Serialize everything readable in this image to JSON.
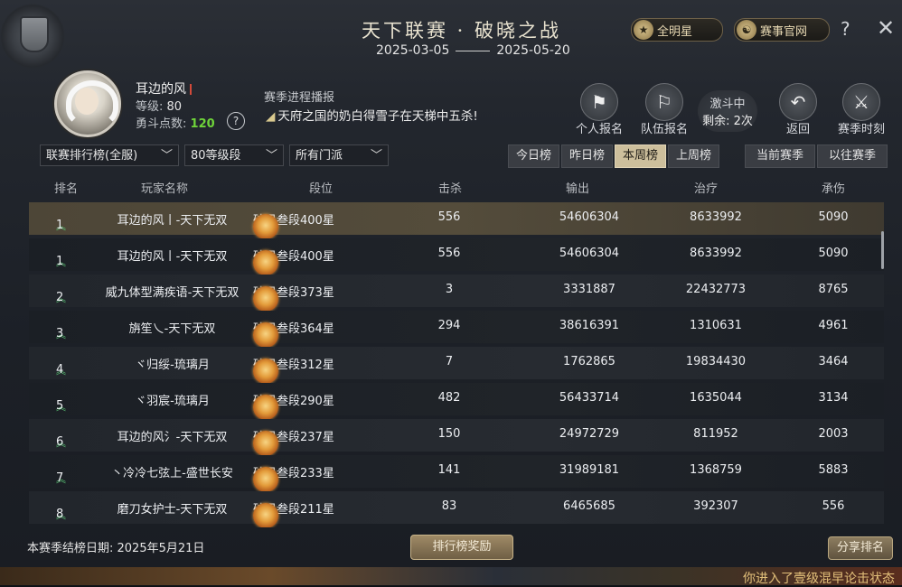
{
  "header": {
    "title": "天下联赛 · 破晓之战",
    "date_start": "2025-03-05",
    "date_end": "2025-05-20",
    "btn_allstar": "全明星",
    "btn_official": "赛事官网",
    "help": "?",
    "close": "✕"
  },
  "player": {
    "name": "耳边的风",
    "level_label": "等级:",
    "level_value": "80",
    "points_label": "勇斗点数:",
    "points_value": "120",
    "help": "?"
  },
  "news": {
    "title": "赛季进程播报",
    "body": "天府之国的奶白得雪子在天梯中五杀!"
  },
  "actions": {
    "solo": "个人报名",
    "team": "队伍报名",
    "fight_status": "激斗中",
    "remaining": "剩余: 2次",
    "back": "返回",
    "moments": "赛季时刻"
  },
  "filters": {
    "board": "联赛排行榜(全服)",
    "level": "80等级段",
    "sect": "所有门派"
  },
  "tabs": [
    "今日榜",
    "昨日榜",
    "本周榜",
    "上周榜"
  ],
  "active_tab": "本周榜",
  "season_tabs": [
    "当前赛季",
    "以往赛季"
  ],
  "columns": {
    "rank": "排名",
    "name": "玩家名称",
    "segment": "段位",
    "kills": "击杀",
    "damage": "输出",
    "healing": "治疗",
    "taken": "承伤"
  },
  "rows": [
    {
      "rank": "1",
      "name": "耳边的风丨-天下无双",
      "segment": "破日叁段400星",
      "kills": "556",
      "damage": "54606304",
      "healing": "8633992",
      "taken": "5090"
    },
    {
      "rank": "1",
      "name": "耳边的风丨-天下无双",
      "segment": "破日叁段400星",
      "kills": "556",
      "damage": "54606304",
      "healing": "8633992",
      "taken": "5090"
    },
    {
      "rank": "2",
      "name": "威九体型满疾语-天下无双",
      "segment": "破日叁段373星",
      "kills": "3",
      "damage": "3331887",
      "healing": "22432773",
      "taken": "8765"
    },
    {
      "rank": "3",
      "name": "旃笙乀-天下无双",
      "segment": "破日叁段364星",
      "kills": "294",
      "damage": "38616391",
      "healing": "1310631",
      "taken": "4961"
    },
    {
      "rank": "4",
      "name": "ヾ归绥-琉璃月",
      "segment": "破日叁段312星",
      "kills": "7",
      "damage": "1762865",
      "healing": "19834430",
      "taken": "3464"
    },
    {
      "rank": "5",
      "name": "ヾ羽宸-琉璃月",
      "segment": "破日叁段290星",
      "kills": "482",
      "damage": "56433714",
      "healing": "1635044",
      "taken": "3134"
    },
    {
      "rank": "6",
      "name": "耳边的风氵-天下无双",
      "segment": "破日叁段237星",
      "kills": "150",
      "damage": "24972729",
      "healing": "811952",
      "taken": "2003"
    },
    {
      "rank": "7",
      "name": "丶冷冷七弦上-盛世长安",
      "segment": "破日叁段233星",
      "kills": "141",
      "damage": "31989181",
      "healing": "1368759",
      "taken": "5883"
    },
    {
      "rank": "8",
      "name": "磨刀女护士-天下无双",
      "segment": "破日叁段211星",
      "kills": "83",
      "damage": "6465685",
      "healing": "392307",
      "taken": "556"
    }
  ],
  "footer": {
    "end_date": "本赛季结榜日期: 2025年5月21日",
    "reward_btn": "排行榜奖励",
    "share_btn": "分享排名"
  },
  "ticker": "你进入了壹级混早论击状态"
}
